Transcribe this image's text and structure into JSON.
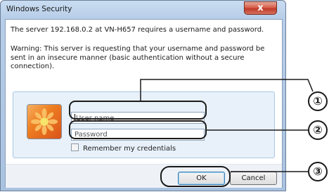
{
  "window": {
    "title": "Windows Security",
    "close_glyph": "x"
  },
  "message": {
    "line1": "The server 192.168.0.2 at VN-H657 requires a username and password.",
    "warning": "Warning: This server is requesting that your username and password be sent in an insecure manner (basic authentication without a secure connection)."
  },
  "credentials": {
    "username_placeholder": "User name",
    "password_placeholder": "Password",
    "remember_label": "Remember my credentials"
  },
  "buttons": {
    "ok": "OK",
    "cancel": "Cancel"
  },
  "callouts": [
    "①",
    "②",
    "③"
  ],
  "colors": {
    "titlebar": "#b7cde8",
    "close_button": "#c0392b",
    "avatar": "#ee7e22",
    "credential_panel": "#e8f1fa"
  },
  "icons": {
    "avatar": "user-avatar-icon",
    "close": "close-icon"
  }
}
